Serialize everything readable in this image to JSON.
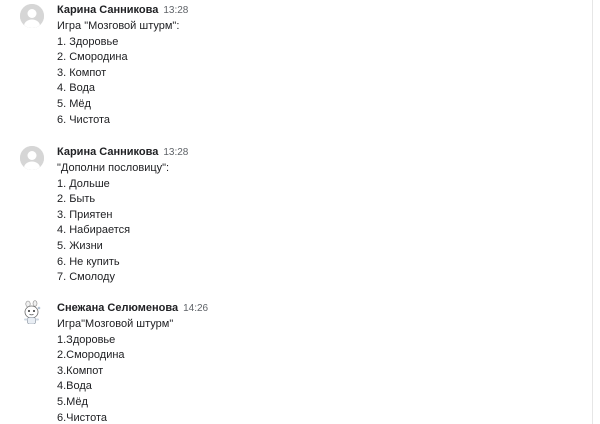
{
  "messages": [
    {
      "author": "Карина Санникова",
      "time": "13:28",
      "avatar_icon": "default-user-avatar-icon",
      "lines": [
        "Игра \"Мозговой штурм\":",
        "1. Здоровье",
        "2. Смородина",
        "3. Компот",
        "4. Вода",
        "5. Мёд",
        "6. Чистота"
      ]
    },
    {
      "author": "Карина Санникова",
      "time": "13:28",
      "avatar_icon": "default-user-avatar-icon",
      "lines": [
        "\"Дополни пословицу\":",
        "1. Дольше",
        "2. Быть",
        "3. Приятен",
        "4. Набирается",
        "5. Жизни",
        "6. Не купить",
        "7. Смолоду"
      ]
    },
    {
      "author": "Снежана Селюменова",
      "time": "14:26",
      "avatar_icon": "cartoon-sticker-avatar-icon",
      "lines": [
        "Игра\"Мозговой штурм\"",
        "1.Здоровье",
        "2.Смородина",
        "3.Компот",
        "4.Вода",
        "5.Мёд",
        "6.Чистота"
      ]
    }
  ],
  "colors": {
    "text": "#202124",
    "timestamp": "#5f6368",
    "avatar_bg": "#d6d6d6",
    "avatar_fg": "#ffffff"
  }
}
